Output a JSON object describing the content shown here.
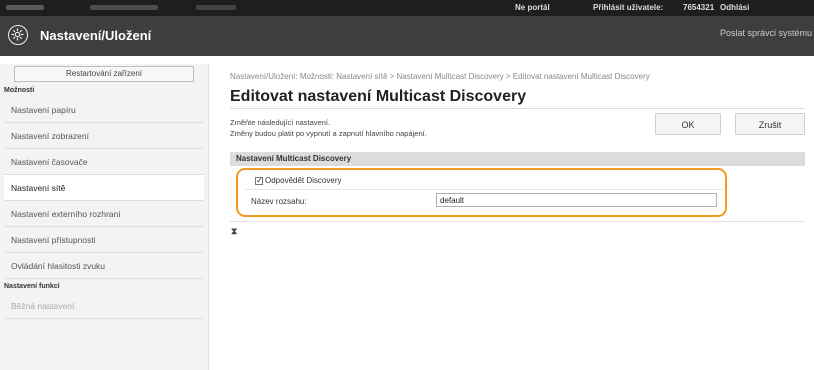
{
  "topbar": {
    "portal_link": "Ne portál",
    "login_label": "Přihlásit uživatele:",
    "user_id": "7654321",
    "logout": "Odhlási"
  },
  "header": {
    "title": "Nastavení/Uložení",
    "send_to_admin": "Poslat správci systému"
  },
  "sidebar": {
    "restart_button": "Restartování zařízení",
    "section_options": "Možnosti",
    "items": [
      {
        "label": "Nastavení papíru"
      },
      {
        "label": "Nastavení zobrazení"
      },
      {
        "label": "Nastavení časovače"
      },
      {
        "label": "Nastavení sítě"
      },
      {
        "label": "Nastavení externího rozhraní"
      },
      {
        "label": "Nastavení přístupnosti"
      },
      {
        "label": "Ovládání hlasitosti zvuku"
      }
    ],
    "section_functions": "Nastavení funkcí",
    "function_items": [
      {
        "label": "Běžná nastavení"
      }
    ]
  },
  "main": {
    "breadcrumb": "Nastavení/Uložení: Možnosti: Nastavení sítě > Nastavení Multicast Discovery > Editovat nastavení Multicast Discovery",
    "title": "Editovat nastavení Multicast Discovery",
    "note_line1": "Změňte následující nastavení.",
    "note_line2": "Změny budou platit po vypnutí a zapnutí hlavního napájení.",
    "ok_button": "OK",
    "cancel_button": "Zrušit",
    "section_title": "Nastavení Multicast Discovery",
    "discovery_checkbox": {
      "label": "Odpovědět Discovery",
      "checked": true
    },
    "scope_label": "Název rozsahu:",
    "scope_value": "default",
    "back_to_top": "⧗"
  },
  "colors": {
    "highlight": "#f29a1f",
    "header_bg": "#3e3e3e",
    "topbar_bg": "#1e1e1e"
  }
}
